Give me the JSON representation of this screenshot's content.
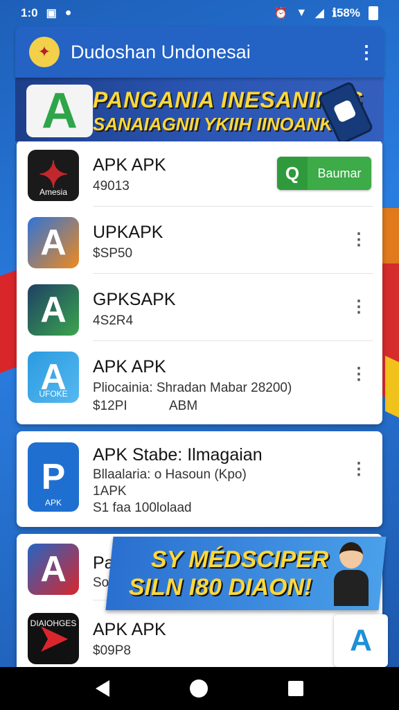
{
  "status": {
    "time": "1:0",
    "battery": "ℹ58%"
  },
  "appbar": {
    "title": "Dudoshan Undonesai"
  },
  "banner": {
    "line1": "PANGANIA INESANIKES",
    "line2": "SANAIAGNII YKIIH IINOANKI!"
  },
  "apps": [
    {
      "name": "APK APK",
      "sub1": "49013",
      "icon_label": "Amesia",
      "button": "Baumar",
      "colors": [
        "#1a1a1a",
        "#c2272d"
      ]
    },
    {
      "name": "UPKAPK",
      "sub1": "$SP50",
      "colors": [
        "#2f74d8",
        "#f08a1c"
      ]
    },
    {
      "name": "GPKSAPK",
      "sub1": "4S2R4",
      "colors": [
        "#1f3f66",
        "#3aa54c"
      ]
    },
    {
      "name": "APK APK",
      "sub1": "Pliocainia: Shradan Mabar 28200)",
      "sub2": "$12PI",
      "sub2b": "ABM",
      "icon_label": "UFOKE",
      "colors": [
        "#2a9be0",
        "#f1c21b"
      ]
    },
    {
      "name": "APK Stabe: Ilmagaian",
      "sub1": "Bllaalaria: o Hasoun (Kpo)",
      "sub2": "1APK",
      "sub3": "S1 faa 100lolaad",
      "icon_label": "APK",
      "colors": [
        "#1f6fd0",
        "#ffffff"
      ]
    },
    {
      "name": "Pabr",
      "sub1": "Son",
      "colors": [
        "#2565c2",
        "#d9262c"
      ]
    },
    {
      "name": "APK APK",
      "sub1": "$09P8",
      "icon_label": "DIAIOHGES",
      "colors": [
        "#111111",
        "#d9262c"
      ]
    }
  ],
  "promo": {
    "line1": "SY MÉDSCIPER",
    "line2": "SILN I80 DIAON!"
  }
}
